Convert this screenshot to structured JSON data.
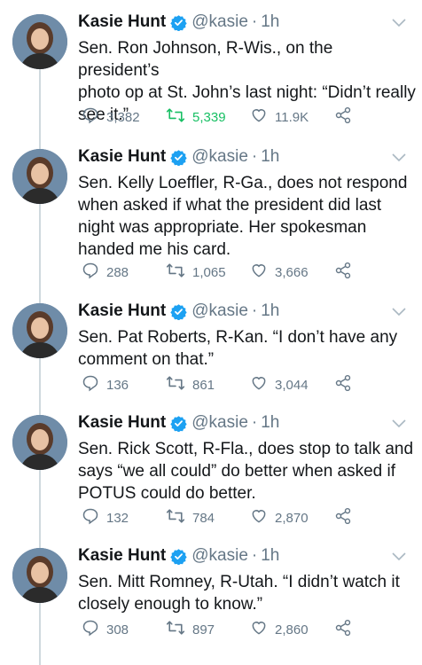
{
  "colors": {
    "accent": "#1da1f2",
    "retweet_active": "#17bf63",
    "muted": "#657786"
  },
  "author": {
    "name": "Kasie Hunt",
    "handle": "@kasie",
    "dot": "·",
    "time": "1h",
    "verified": true
  },
  "tweets": [
    {
      "text": "Sen. Ron Johnson, R-Wis., on the president’s\nphoto op at St. John’s last night: “Didn’t really\nsee it.”",
      "replies": "3,382",
      "retweets": "5,339",
      "likes": "11.9K",
      "retweeted": true
    },
    {
      "text": "Sen. Kelly Loeffler, R-Ga., does not respond\nwhen asked if what the president did last\nnight was appropriate. Her spokesman\nhanded me his card.",
      "replies": "288",
      "retweets": "1,065",
      "likes": "3,666",
      "retweeted": false
    },
    {
      "text": "Sen. Pat Roberts, R-Kan. “I don’t have any\ncomment on that.”",
      "replies": "136",
      "retweets": "861",
      "likes": "3,044",
      "retweeted": false
    },
    {
      "text": "Sen. Rick Scott, R-Fla., does stop to talk and\nsays “we all could” do better when asked if\nPOTUS could do better.",
      "replies": "132",
      "retweets": "784",
      "likes": "2,870",
      "retweeted": false
    },
    {
      "text": "Sen. Mitt Romney, R-Utah. “I didn’t watch it\nclosely enough to know.”",
      "replies": "308",
      "retweets": "897",
      "likes": "2,860",
      "retweeted": false
    }
  ],
  "icons": {
    "reply": "reply-icon",
    "retweet": "retweet-icon",
    "like": "heart-icon",
    "share": "share-icon",
    "more": "chevron-down-icon",
    "verified": "verified-badge-icon"
  }
}
